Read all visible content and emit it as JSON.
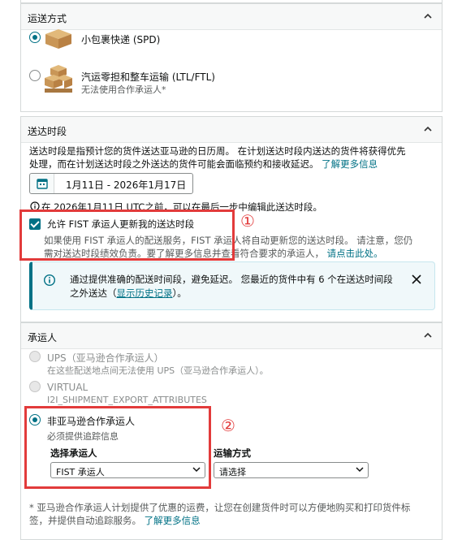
{
  "shipping_mode": {
    "title": "运送方式",
    "options": [
      {
        "label": "小包裹快递 (SPD)",
        "sublabel": "",
        "selected": true
      },
      {
        "label": "汽运零担和整车运输 (LTL/FTL)",
        "sublabel": "无法使用合作承运人*",
        "selected": false
      }
    ]
  },
  "delivery_window": {
    "title": "送达时段",
    "desc_line1": "送达时段是指预计您的货件送达亚马逊的日历周。 在计划送达时段内送达的货件将获得优先",
    "desc_line2": "处理，而在计划送达时段之外送达的货件可能会面临预约和接收延迟。",
    "learn_more": "了解更多信息",
    "date_range": "1月11日 - 2026年1月17日",
    "edit_note": "在 2026年1月11日 UTC之前，可以在最后一步中编辑此送达时段。",
    "allow_label": "允许 FIST 承运人更新我的送达时段",
    "allow_desc_line1": "如果使用 FIST 承运人的配送服务，FIST 承运人将自动更新您的送达时段。 请注意，您仍",
    "allow_desc_line2": "需对送达时段绩效负责。要了解更多信息并查看符合要求的承运人，",
    "allow_link": "请点击此处。",
    "info_line1": "通过提供准确的配送时间段，避免延迟。 您最近的货件中有 6 个在送达时间段",
    "info_line2": "之外送达（",
    "info_link": "显示历史记录",
    "info_line2_end": "）。"
  },
  "carrier": {
    "title": "承运人",
    "options": [
      {
        "label": "UPS（亚马逊合作承运人）",
        "sublabel": "在这些配送地点间无法使用 UPS（亚马逊合作承运人）。",
        "state": "disabled"
      },
      {
        "label": "VIRTUAL",
        "sublabel": "I2I_SHIPMENT_EXPORT_ATTRIBUTES",
        "state": "disabled"
      },
      {
        "label": "非亚马逊合作承运人",
        "sublabel": "必须提供追踪信息",
        "state": "selected"
      }
    ],
    "select_carrier_label": "选择承运人",
    "select_carrier_value": "FIST 承运人",
    "transport_label": "运输方式",
    "transport_value": "请选择",
    "footnote_line1": "* 亚马逊合作承运人计划提供了优惠的运费，让您在创建货件时可以方便地购买和打印货件标",
    "footnote_line2": "签，并提供自动追踪服务。",
    "footnote_link": "了解更多信息"
  },
  "annotations": {
    "marker1": "①",
    "marker2": "②"
  },
  "colors": {
    "accent": "#007185",
    "annotation_red": "#e23b3b",
    "info_bg": "#f0f8fa"
  }
}
